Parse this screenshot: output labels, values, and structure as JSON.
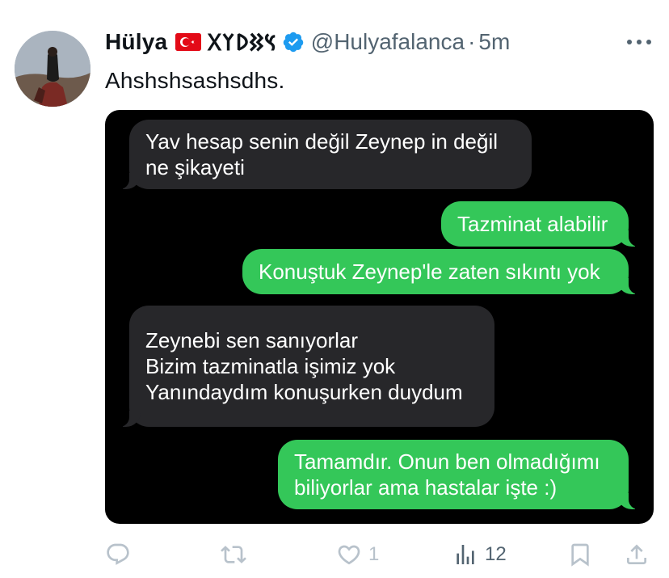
{
  "tweet": {
    "display_name": "Hülya",
    "flag_icon": "turkey-flag-icon",
    "runes": "𐰽𐰑𐰖𐰠𐰓",
    "handle": "@Hulyafalanca",
    "separator": "·",
    "time": "5m",
    "text": "Ahshshsashsdhs."
  },
  "conversation": {
    "messages": [
      {
        "side": "received",
        "lines": [
          "Yav hesap senin değil Zeynep in değil",
          "ne şikayeti"
        ]
      },
      {
        "side": "sent",
        "lines": [
          "Tazminat alabilir"
        ]
      },
      {
        "side": "sent",
        "lines": [
          "Konuştuk Zeynep'le zaten sıkıntı yok"
        ]
      },
      {
        "side": "received",
        "lines": [
          "Zeynebi sen sanıyorlar",
          "Bizim tazminatla işimiz yok",
          "",
          "Yanındaydım konuşurken duydum"
        ]
      },
      {
        "side": "sent",
        "lines": [
          "Tamamdır. Onun ben olmadığımı",
          "biliyorlar ama hastalar işte :)"
        ]
      }
    ]
  },
  "actions": {
    "reply_count": "",
    "retweet_count": "",
    "like_count": "1",
    "view_count": "12"
  },
  "colors": {
    "sent_bubble": "#34c759",
    "received_bubble": "#27272a",
    "verified": "#1d9bf0",
    "muted": "#536471"
  }
}
